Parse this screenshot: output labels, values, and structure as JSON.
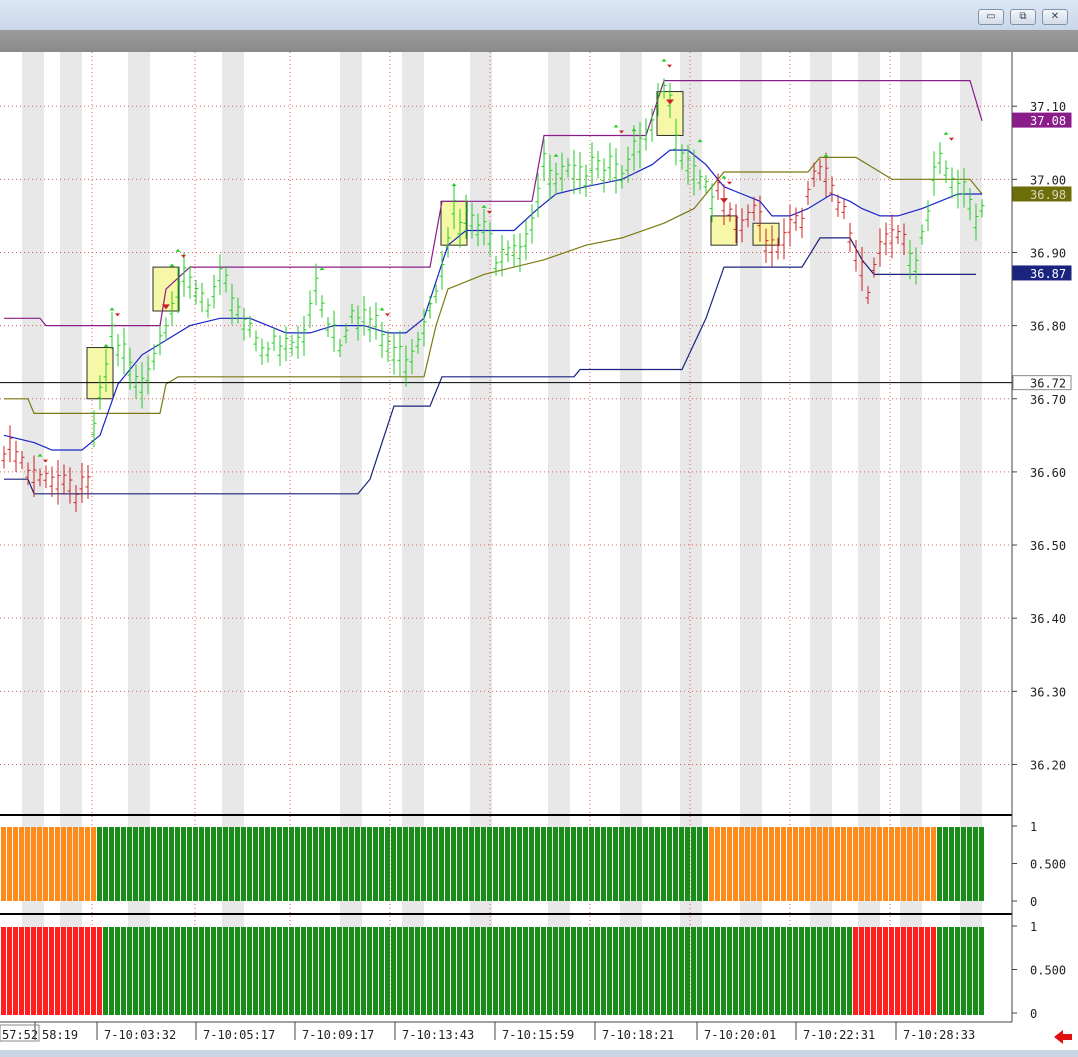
{
  "window": {
    "minimize_glyph": "▭",
    "restore_glyph": "⧉",
    "close_glyph": "✕"
  },
  "colors": {
    "bg": "#ffffff",
    "shade": "#e8e8e8",
    "grid": "#e06060",
    "bar_up": "#22cc22",
    "bar_down": "#cc2222",
    "ma_blue": "#1a24c8",
    "upper_purple": "#8a1d8a",
    "olive": "#7a7a10",
    "lower_navy": "#1a237e",
    "signal_green": "#1a8c1a",
    "signal_orange": "#ff8c1a",
    "signal_red": "#ff1f1f",
    "box_fill": "#f7f7a8",
    "box_stroke": "#2d2d2d",
    "scroll_arrow": "#e01010"
  },
  "chart_data": [
    {
      "type": "line",
      "panel": "price",
      "y_ticks": [
        "37.10",
        "37.00",
        "36.90",
        "36.80",
        "36.70",
        "36.60",
        "36.50",
        "36.40",
        "36.30",
        "36.20"
      ],
      "ylim": [
        36.135,
        37.17
      ],
      "x_labels": [
        "57:52",
        "58:19",
        "7-10:03:32",
        "7-10:05:17",
        "7-10:09:17",
        "7-10:13:43",
        "7-10:15:59",
        "7-10:18:21",
        "7-10:20:01",
        "7-10:22:31",
        "7-10:28:33"
      ],
      "bar_count": 165,
      "price_tags": [
        {
          "label": "37.08",
          "value": 37.081,
          "bg": "#8a1d8a",
          "fg": "#ffffff"
        },
        {
          "label": "36.98",
          "value": 36.98,
          "bg": "#6d6d0a",
          "fg": "#d7d7c0"
        },
        {
          "label": "36.87",
          "value": 36.872,
          "bg": "#1a237e",
          "fg": "#ffffff"
        },
        {
          "label": "36.72",
          "value": 36.722,
          "bg": "#ffffff",
          "fg": "#222222"
        }
      ],
      "horizontal_line": 36.722,
      "series": [
        {
          "role": "upper_band",
          "points": [
            [
              0,
              36.81
            ],
            [
              6,
              36.81
            ],
            [
              7,
              36.8
            ],
            [
              26,
              36.8
            ],
            [
              27,
              36.85
            ],
            [
              31,
              36.88
            ],
            [
              71,
              36.88
            ],
            [
              73,
              36.97
            ],
            [
              88,
              36.97
            ],
            [
              90,
              37.06
            ],
            [
              107,
              37.06
            ],
            [
              110,
              37.135
            ],
            [
              161,
              37.135
            ],
            [
              163,
              37.08
            ]
          ]
        },
        {
          "role": "middle_band",
          "points": [
            [
              0,
              36.7
            ],
            [
              4,
              36.7
            ],
            [
              5,
              36.68
            ],
            [
              26,
              36.68
            ],
            [
              27,
              36.72
            ],
            [
              29,
              36.73
            ],
            [
              70,
              36.73
            ],
            [
              72,
              36.8
            ],
            [
              74,
              36.85
            ],
            [
              80,
              36.87
            ],
            [
              90,
              36.89
            ],
            [
              97,
              36.91
            ],
            [
              103,
              36.92
            ],
            [
              110,
              36.94
            ],
            [
              115,
              36.96
            ],
            [
              120,
              37.01
            ],
            [
              134,
              37.01
            ],
            [
              136,
              37.03
            ],
            [
              142,
              37.03
            ],
            [
              148,
              37.0
            ],
            [
              161,
              37.0
            ],
            [
              163,
              36.98
            ]
          ]
        },
        {
          "role": "lower_band",
          "points": [
            [
              0,
              36.59
            ],
            [
              4,
              36.59
            ],
            [
              5,
              36.57
            ],
            [
              59,
              36.57
            ],
            [
              61,
              36.59
            ],
            [
              65,
              36.69
            ],
            [
              71,
              36.69
            ],
            [
              73,
              36.73
            ],
            [
              95,
              36.73
            ],
            [
              96,
              36.74
            ],
            [
              113,
              36.74
            ],
            [
              117,
              36.81
            ],
            [
              120,
              36.88
            ],
            [
              133,
              36.88
            ],
            [
              136,
              36.92
            ],
            [
              141,
              36.92
            ],
            [
              143,
              36.89
            ],
            [
              145,
              36.87
            ],
            [
              162,
              36.87
            ]
          ]
        },
        {
          "role": "moving_average",
          "points": [
            [
              0,
              36.65
            ],
            [
              5,
              36.64
            ],
            [
              8,
              36.63
            ],
            [
              13,
              36.63
            ],
            [
              16,
              36.65
            ],
            [
              19,
              36.72
            ],
            [
              23,
              36.76
            ],
            [
              27,
              36.78
            ],
            [
              31,
              36.8
            ],
            [
              36,
              36.81
            ],
            [
              41,
              36.81
            ],
            [
              44,
              36.8
            ],
            [
              47,
              36.79
            ],
            [
              51,
              36.79
            ],
            [
              55,
              36.8
            ],
            [
              60,
              36.8
            ],
            [
              64,
              36.79
            ],
            [
              67,
              36.79
            ],
            [
              70,
              36.81
            ],
            [
              72,
              36.86
            ],
            [
              74,
              36.91
            ],
            [
              77,
              36.93
            ],
            [
              80,
              36.93
            ],
            [
              85,
              36.93
            ],
            [
              89,
              36.96
            ],
            [
              92,
              36.98
            ],
            [
              97,
              36.99
            ],
            [
              103,
              37.0
            ],
            [
              108,
              37.02
            ],
            [
              111,
              37.04
            ],
            [
              114,
              37.04
            ],
            [
              117,
              37.02
            ],
            [
              120,
              36.99
            ],
            [
              123,
              36.98
            ],
            [
              126,
              36.97
            ],
            [
              128,
              36.95
            ],
            [
              131,
              36.95
            ],
            [
              134,
              36.96
            ],
            [
              138,
              36.98
            ],
            [
              141,
              36.97
            ],
            [
              143,
              36.96
            ],
            [
              146,
              36.95
            ],
            [
              149,
              36.95
            ],
            [
              153,
              36.96
            ],
            [
              156,
              36.97
            ],
            [
              159,
              36.98
            ],
            [
              163,
              36.98
            ]
          ]
        }
      ],
      "price_path": [
        [
          0,
          36.63
        ],
        [
          2,
          36.63
        ],
        [
          4,
          36.6
        ],
        [
          6,
          36.59
        ],
        [
          8,
          36.61
        ],
        [
          10,
          36.6
        ],
        [
          12,
          36.59
        ],
        [
          14,
          36.6
        ],
        [
          15,
          36.66
        ],
        [
          16,
          36.7
        ],
        [
          17,
          36.74
        ],
        [
          18,
          36.79
        ],
        [
          19,
          36.77
        ],
        [
          20,
          36.76
        ],
        [
          22,
          36.72
        ],
        [
          24,
          36.76
        ],
        [
          26,
          36.8
        ],
        [
          28,
          36.85
        ],
        [
          29,
          36.87
        ],
        [
          30,
          36.86
        ],
        [
          32,
          36.85
        ],
        [
          34,
          36.83
        ],
        [
          36,
          36.86
        ],
        [
          38,
          36.85
        ],
        [
          40,
          36.82
        ],
        [
          42,
          36.8
        ],
        [
          44,
          36.78
        ],
        [
          46,
          36.77
        ],
        [
          48,
          36.78
        ],
        [
          50,
          36.79
        ],
        [
          52,
          36.87
        ],
        [
          54,
          36.82
        ],
        [
          56,
          36.79
        ],
        [
          58,
          36.84
        ],
        [
          60,
          36.82
        ],
        [
          62,
          36.8
        ],
        [
          64,
          36.78
        ],
        [
          66,
          36.76
        ],
        [
          68,
          36.78
        ],
        [
          70,
          36.82
        ],
        [
          72,
          36.87
        ],
        [
          74,
          36.94
        ],
        [
          75,
          36.96
        ],
        [
          76,
          36.94
        ],
        [
          78,
          36.95
        ],
        [
          80,
          36.93
        ],
        [
          82,
          36.91
        ],
        [
          84,
          36.93
        ],
        [
          86,
          36.92
        ],
        [
          88,
          36.96
        ],
        [
          90,
          37.02
        ],
        [
          92,
          37.0
        ],
        [
          94,
          37.01
        ],
        [
          96,
          37.0
        ],
        [
          98,
          37.05
        ],
        [
          100,
          37.03
        ],
        [
          102,
          37.04
        ],
        [
          104,
          37.02
        ],
        [
          106,
          37.05
        ],
        [
          108,
          37.07
        ],
        [
          110,
          37.13
        ],
        [
          112,
          37.08
        ],
        [
          114,
          37.04
        ],
        [
          116,
          37.02
        ],
        [
          118,
          36.99
        ],
        [
          120,
          36.97
        ],
        [
          122,
          36.93
        ],
        [
          124,
          36.96
        ],
        [
          126,
          36.95
        ],
        [
          128,
          36.92
        ],
        [
          130,
          36.94
        ],
        [
          132,
          36.96
        ],
        [
          134,
          36.98
        ],
        [
          136,
          37.02
        ],
        [
          138,
          36.98
        ],
        [
          140,
          36.96
        ],
        [
          142,
          36.91
        ],
        [
          144,
          36.87
        ],
        [
          146,
          36.92
        ],
        [
          148,
          36.94
        ],
        [
          150,
          36.91
        ],
        [
          152,
          36.89
        ],
        [
          154,
          36.95
        ],
        [
          155,
          37.0
        ],
        [
          156,
          37.04
        ],
        [
          158,
          37.02
        ],
        [
          160,
          37.0
        ],
        [
          162,
          36.97
        ],
        [
          163,
          36.98
        ]
      ],
      "up_segments": [
        [
          15,
          118
        ],
        [
          151,
          163
        ]
      ],
      "highlight_boxes": [
        {
          "bar": 16,
          "top": 36.77,
          "bottom": 36.7
        },
        {
          "bar": 27,
          "top": 36.88,
          "bottom": 36.82
        },
        {
          "bar": 75,
          "top": 36.97,
          "bottom": 36.91
        },
        {
          "bar": 111,
          "top": 37.12,
          "bottom": 37.06
        },
        {
          "bar": 120,
          "top": 36.95,
          "bottom": 36.91
        },
        {
          "bar": 127,
          "top": 36.94,
          "bottom": 36.91
        }
      ]
    },
    {
      "type": "bar",
      "panel": "signal_1",
      "y_ticks": [
        "1",
        "0.500",
        "0"
      ],
      "ylim": [
        0,
        1
      ],
      "bar_count": 165,
      "segments": [
        {
          "from": 0,
          "to": 15,
          "value": 1,
          "state": "orange"
        },
        {
          "from": 16,
          "to": 117,
          "value": 1,
          "state": "green"
        },
        {
          "from": 118,
          "to": 155,
          "value": 1,
          "state": "orange"
        },
        {
          "from": 156,
          "to": 163,
          "value": 1,
          "state": "green"
        }
      ]
    },
    {
      "type": "bar",
      "panel": "signal_2",
      "y_ticks": [
        "1",
        "0.500",
        "0"
      ],
      "ylim": [
        0,
        1
      ],
      "bar_count": 165,
      "segments": [
        {
          "from": 0,
          "to": 16,
          "value": 1,
          "state": "red"
        },
        {
          "from": 17,
          "to": 141,
          "value": 1,
          "state": "green"
        },
        {
          "from": 142,
          "to": 155,
          "value": 1,
          "state": "red"
        },
        {
          "from": 156,
          "to": 163,
          "value": 1,
          "state": "green"
        }
      ]
    }
  ]
}
